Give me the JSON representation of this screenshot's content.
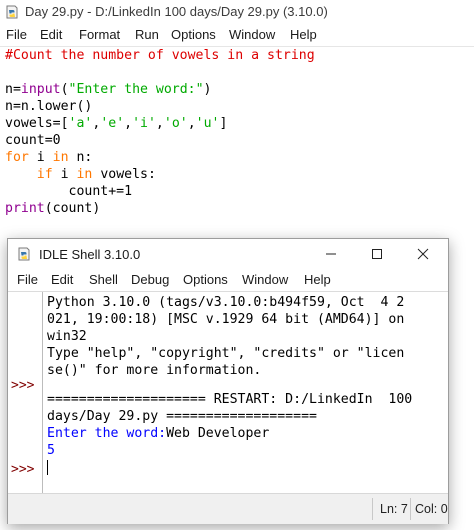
{
  "editor": {
    "title": "Day 29.py - D:/LinkedIn  100 days/Day 29.py (3.10.0)",
    "menu": [
      "File",
      "Edit",
      "Format",
      "Run",
      "Options",
      "Window",
      "Help"
    ],
    "code": {
      "line1": "#Count the number of vowels in a string",
      "line3_a": "n=",
      "line3_b": "input",
      "line3_c": "(",
      "line3_d": "\"Enter the word:\"",
      "line3_e": ")",
      "line4": "n=n.lower()",
      "line5_a": "vowels=[",
      "line5_b": "'a'",
      "line5_c": ",",
      "line5_d": "'e'",
      "line5_e": ",",
      "line5_f": "'i'",
      "line5_g": ",",
      "line5_h": "'o'",
      "line5_i": ",",
      "line5_j": "'u'",
      "line5_k": "]",
      "line6": "count=0",
      "line7_a": "for",
      "line7_b": " i ",
      "line7_c": "in",
      "line7_d": " n:",
      "line8_a": "    ",
      "line8_b": "if",
      "line8_c": " i ",
      "line8_d": "in",
      "line8_e": " vowels:",
      "line9": "        count+=1",
      "line10_a": "print",
      "line10_b": "(count)"
    }
  },
  "shell": {
    "title": "IDLE Shell 3.10.0",
    "menu": [
      "File",
      "Edit",
      "Shell",
      "Debug",
      "Options",
      "Window",
      "Help"
    ],
    "prompt": ">>>",
    "lines": {
      "l1": "Python 3.10.0 (tags/v3.10.0:b494f59, Oct  4 2",
      "l2": "021, 19:00:18) [MSC v.1929 64 bit (AMD64)] on",
      "l3": "win32",
      "l4": "Type \"help\", \"copyright\", \"credits\" or \"licen",
      "l5": "se()\" for more information.",
      "l6": "==================== RESTART: D:/LinkedIn  100",
      "l7": "days/Day 29.py ===================",
      "l8_prompt": "Enter the word:",
      "l8_input": "Web Developer",
      "l9": "5"
    },
    "status": {
      "line": "Ln: 7",
      "col": "Col: 0"
    }
  }
}
